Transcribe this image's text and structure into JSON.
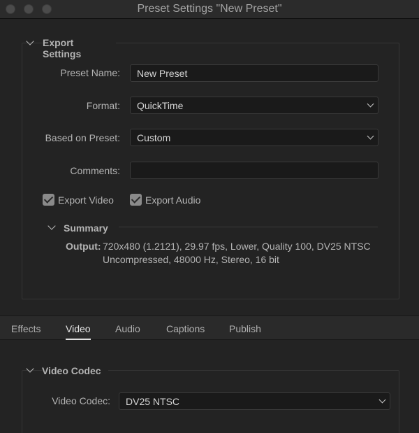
{
  "window": {
    "title": "Preset Settings \"New Preset\""
  },
  "export_settings": {
    "header": "Export Settings",
    "preset_name": {
      "label": "Preset Name:",
      "value": "New Preset"
    },
    "format": {
      "label": "Format:",
      "value": "QuickTime"
    },
    "based_on_preset": {
      "label": "Based on Preset:",
      "value": "Custom"
    },
    "comments": {
      "label": "Comments:",
      "value": ""
    },
    "export_video": {
      "label": "Export Video",
      "checked": true
    },
    "export_audio": {
      "label": "Export Audio",
      "checked": true
    },
    "summary": {
      "header": "Summary",
      "output_label": "Output:",
      "output_line1": "720x480 (1.2121), 29.97 fps, Lower, Quality 100, DV25 NTSC",
      "output_line2": "Uncompressed, 48000 Hz, Stereo, 16 bit"
    }
  },
  "tabs": [
    {
      "label": "Effects",
      "active": false
    },
    {
      "label": "Video",
      "active": true
    },
    {
      "label": "Audio",
      "active": false
    },
    {
      "label": "Captions",
      "active": false
    },
    {
      "label": "Publish",
      "active": false
    }
  ],
  "video_codec_section": {
    "header": "Video Codec",
    "video_codec": {
      "label": "Video Codec:",
      "value": "DV25 NTSC"
    }
  },
  "icons": {
    "window_close": "close-traffic-light-icon",
    "window_minimize": "minimize-traffic-light-icon",
    "window_zoom": "zoom-traffic-light-icon",
    "section_toggle": "chevron-down-icon",
    "dropdown": "chevron-down-icon",
    "checkbox": "checkmark-icon"
  },
  "colors": {
    "background": "#232323",
    "field_background": "#1a1a1a",
    "text": "#b4b4b4",
    "active_tab": "#e6e6e6"
  }
}
